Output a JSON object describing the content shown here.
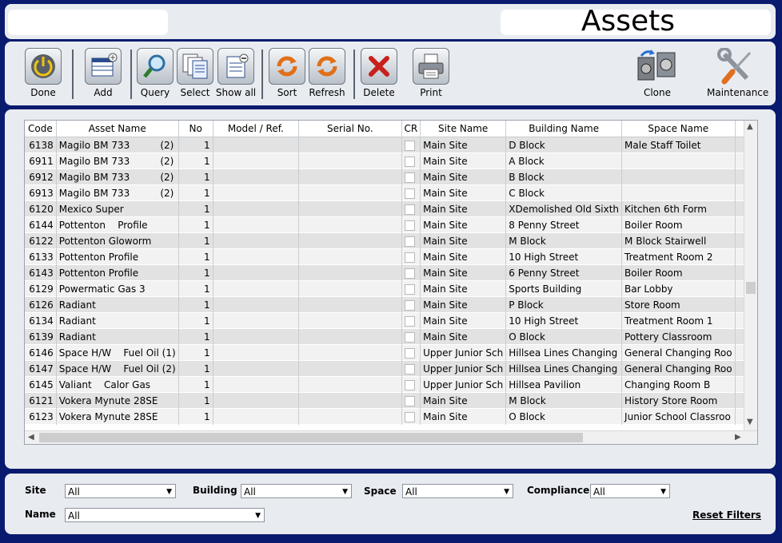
{
  "header": {
    "title": "Assets"
  },
  "toolbar": {
    "done": "Done",
    "add": "Add",
    "query": "Query",
    "select": "Select",
    "show_all": "Show all",
    "sort": "Sort",
    "refresh": "Refresh",
    "delete": "Delete",
    "print": "Print",
    "clone": "Clone",
    "maintenance": "Maintenance"
  },
  "grid": {
    "columns": [
      "Code",
      "Asset Name",
      "No",
      "Model  / Ref.",
      "Serial No.",
      "CR",
      "Site Name",
      "Building Name",
      "Space Name"
    ],
    "rows": [
      {
        "code": "6138",
        "asset": "Magilo BM 733          (2)",
        "no": "1",
        "site": "Main Site",
        "building": "D Block",
        "space": "Male Staff Toilet"
      },
      {
        "code": "6911",
        "asset": "Magilo BM 733          (2)",
        "no": "1",
        "site": "Main Site",
        "building": "A Block",
        "space": ""
      },
      {
        "code": "6912",
        "asset": "Magilo BM 733          (2)",
        "no": "1",
        "site": "Main Site",
        "building": "B Block",
        "space": ""
      },
      {
        "code": "6913",
        "asset": "Magilo BM 733          (2)",
        "no": "1",
        "site": "Main Site",
        "building": "C Block",
        "space": ""
      },
      {
        "code": "6120",
        "asset": "Mexico Super",
        "no": "1",
        "site": "Main Site",
        "building": "XDemolished Old Sixth",
        "space": "Kitchen 6th Form"
      },
      {
        "code": "6144",
        "asset": "Pottenton    Profile",
        "no": "1",
        "site": "Main Site",
        "building": "8 Penny Street",
        "space": "Boiler Room"
      },
      {
        "code": "6122",
        "asset": "Pottenton Gloworm",
        "no": "1",
        "site": "Main Site",
        "building": "M Block",
        "space": "M Block Stairwell"
      },
      {
        "code": "6133",
        "asset": "Pottenton Profile",
        "no": "1",
        "site": "Main Site",
        "building": "10 High Street",
        "space": "Treatment Room 2"
      },
      {
        "code": "6143",
        "asset": "Pottenton Profile",
        "no": "1",
        "site": "Main Site",
        "building": "6 Penny Street",
        "space": "Boiler Room"
      },
      {
        "code": "6129",
        "asset": "Powermatic Gas 3",
        "no": "1",
        "site": "Main Site",
        "building": "Sports Building",
        "space": "Bar Lobby"
      },
      {
        "code": "6126",
        "asset": "Radiant",
        "no": "1",
        "site": "Main Site",
        "building": "P Block",
        "space": "Store Room"
      },
      {
        "code": "6134",
        "asset": "Radiant",
        "no": "1",
        "site": "Main Site",
        "building": "10 High Street",
        "space": "Treatment Room 1"
      },
      {
        "code": "6139",
        "asset": "Radiant",
        "no": "1",
        "site": "Main Site",
        "building": "O Block",
        "space": "Pottery Classroom"
      },
      {
        "code": "6146",
        "asset": "Space H/W    Fuel Oil (1)",
        "no": "1",
        "site": "Upper Junior Sch",
        "building": "Hillsea Lines Changing",
        "space": "General Changing Roo"
      },
      {
        "code": "6147",
        "asset": "Space H/W    Fuel Oil (2)",
        "no": "1",
        "site": "Upper Junior Sch",
        "building": "Hillsea Lines Changing",
        "space": "General Changing Roo"
      },
      {
        "code": "6145",
        "asset": "Valiant    Calor Gas",
        "no": "1",
        "site": "Upper Junior Sch",
        "building": "Hillsea Pavilion",
        "space": "Changing Room B"
      },
      {
        "code": "6121",
        "asset": "Vokera Mynute 28SE",
        "no": "1",
        "site": "Main Site",
        "building": "M Block",
        "space": "History Store Room"
      },
      {
        "code": "6123",
        "asset": "Vokera Mynute 28SE",
        "no": "1",
        "site": "Main Site",
        "building": "O Block",
        "space": "Junior School Classroo"
      }
    ]
  },
  "filters": {
    "site_label": "Site",
    "site_value": "All",
    "building_label": "Building",
    "building_value": "All",
    "space_label": "Space",
    "space_value": "All",
    "compliance_label": "Compliance",
    "compliance_value": "All",
    "name_label": "Name",
    "name_value": "All",
    "reset": "Reset Filters"
  },
  "colors": {
    "frame": "#0a1a6e",
    "panel": "#e8ecf1",
    "row_odd": "#e2e2e2",
    "row_even": "#f2f2f2",
    "delete_red": "#c8201c",
    "sort_orange": "#e0701a"
  }
}
